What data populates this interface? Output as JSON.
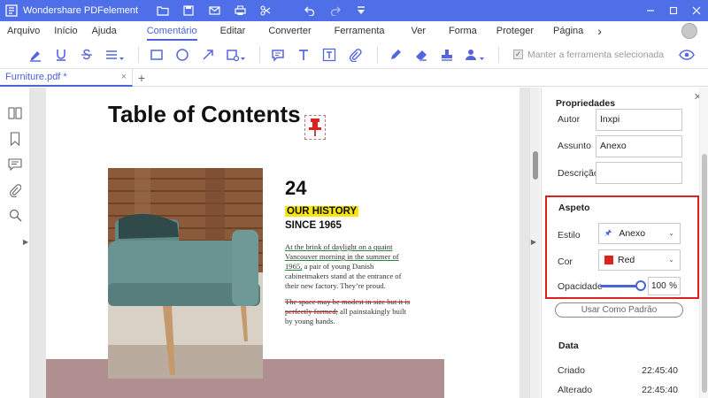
{
  "titlebar": {
    "app_title": "Wondershare PDFelement",
    "quick_icons": [
      "folder-icon",
      "save-icon",
      "mail-icon",
      "print-icon",
      "scissors-icon",
      "undo-icon",
      "redo-icon",
      "dropdown-icon"
    ],
    "window_buttons": [
      "minimize-icon",
      "maximize-icon",
      "close-icon"
    ],
    "color": "#4f6fe8"
  },
  "menu": {
    "items": [
      "Arquivo",
      "Início",
      "Ajuda",
      "Comentário",
      "Editar",
      "Converter",
      "Ferramenta",
      "Ver",
      "Forma",
      "Proteger",
      "Página"
    ],
    "active": "Comentário",
    "more": "›"
  },
  "toolbar": {
    "icons": [
      "highlight-icon",
      "underline-icon",
      "strikethrough-icon",
      "replace-text-icon",
      "rectangle-icon",
      "circle-icon",
      "arrow-icon",
      "shape-more-icon",
      "note-icon",
      "textbox-icon",
      "typewriter-icon",
      "attachment-icon",
      "pencil-icon",
      "eraser-icon",
      "stamp-icon",
      "signature-icon"
    ],
    "keep_tool_label": "Manter a ferramenta selecionada",
    "accent": "#4a64d8"
  },
  "tabs": {
    "items": [
      {
        "label": "Furniture.pdf *",
        "close": "×"
      }
    ],
    "add": "+"
  },
  "document": {
    "title": "Table of Contents",
    "number": "24",
    "history_heading": "OUR HISTORY",
    "since_heading": "SINCE 1965",
    "para1_underlined": "At the brink of daylight on a quaint Vancouver morning in the summer of 1965,",
    "para1_rest": " a pair of young Danish cabinetmakers stand at the entrance of their new factory. They’re proud.",
    "para2_struck": "The space may be modest in size but it is perfectly formed;",
    "para2_rest": " all painstakingly built by young hands."
  },
  "properties": {
    "title": "Propriedades",
    "author_label": "Autor",
    "author_value": "Inxpi",
    "subject_label": "Assunto",
    "subject_value": "Anexo",
    "description_label": "Descrição",
    "description_value": "",
    "aspect_title": "Aspeto",
    "style_label": "Estilo",
    "style_value": "Anexo",
    "color_label": "Cor",
    "color_value": "Red",
    "color_swatch": "#e02020",
    "opacity_label": "Opacidade",
    "opacity_value": "100",
    "opacity_unit": "%",
    "opacity_level": 1.0,
    "default_button": "Usar Como Padrão",
    "date_title": "Data",
    "created_label": "Criado",
    "created_value": "22:45:40",
    "modified_label": "Alterado",
    "modified_value": "22:45:40"
  }
}
